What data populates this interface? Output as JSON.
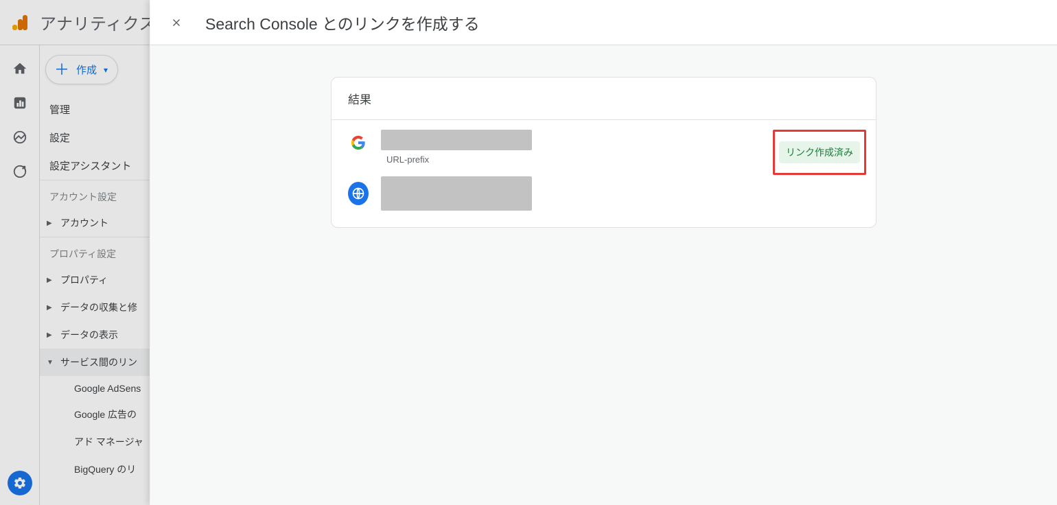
{
  "header": {
    "app_title": "アナリティクス"
  },
  "sidebar": {
    "create_label": "作成",
    "links": {
      "admin": "管理",
      "settings": "設定",
      "assistant": "設定アシスタント"
    },
    "account_section": "アカウント設定",
    "account_item": "アカウント",
    "property_section": "プロパティ設定",
    "property_items": {
      "property": "プロパティ",
      "collection": "データの収集と修",
      "display": "データの表示",
      "links": "サービス間のリン"
    },
    "sub_items": {
      "adsense": "Google AdSens",
      "ads": "Google 広告の",
      "admanager": "アド マネージャ",
      "bigquery": "BigQuery のリ"
    }
  },
  "modal": {
    "title": "Search Console とのリンクを作成する",
    "card_title": "結果",
    "url_prefix_label": "URL-prefix",
    "badge_label": "リンク作成済み"
  }
}
